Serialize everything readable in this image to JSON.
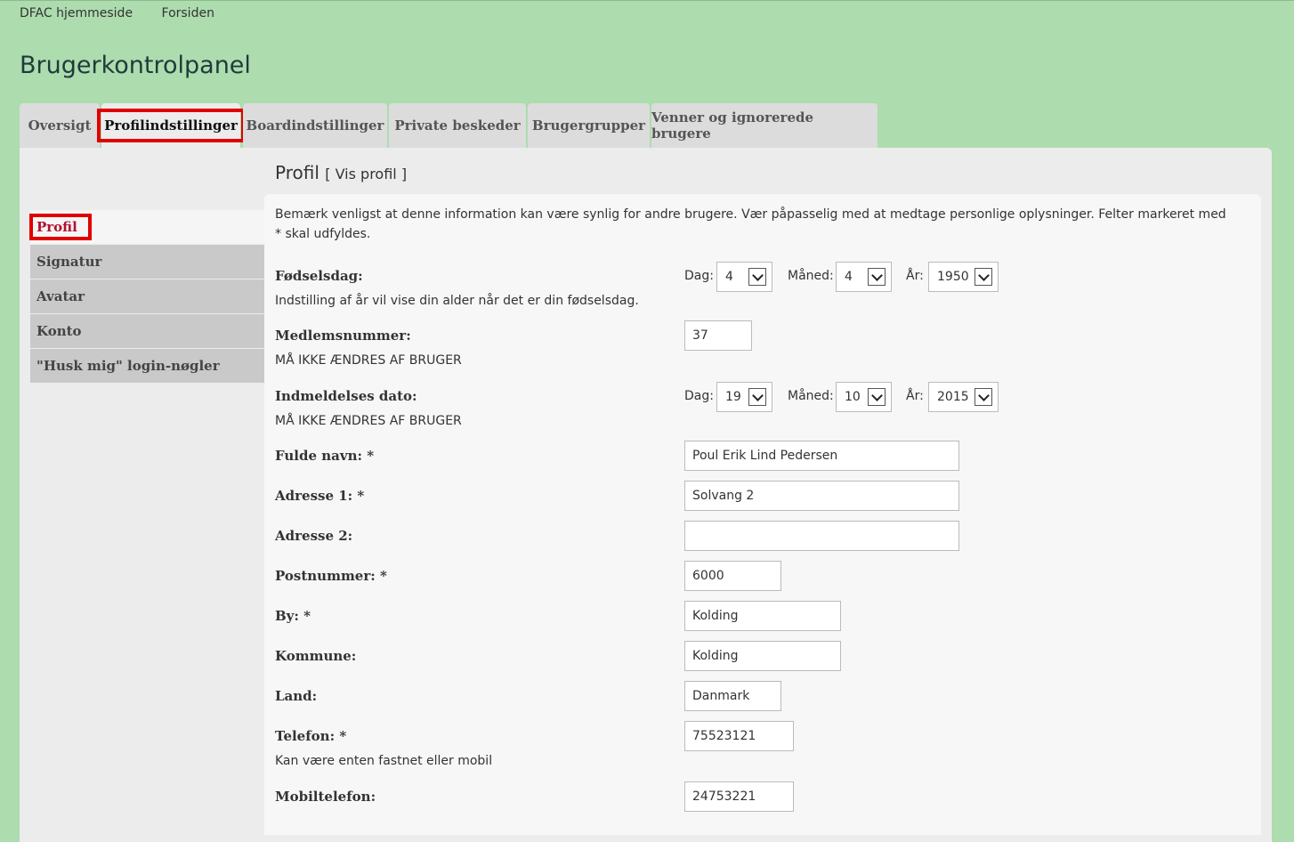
{
  "breadcrumbs": [
    "DFAC hjemmeside",
    "Forsiden"
  ],
  "page_title": "Brugerkontrolpanel",
  "tabs": [
    {
      "label": "Oversigt"
    },
    {
      "label": "Profilindstillinger"
    },
    {
      "label": "Boardindstillinger"
    },
    {
      "label": "Private beskeder"
    },
    {
      "label": "Brugergrupper"
    },
    {
      "label": "Venner og ignorerede brugere"
    }
  ],
  "active_tab": "Profilindstillinger",
  "sidebar": {
    "items": [
      {
        "label": "Profil"
      },
      {
        "label": "Signatur"
      },
      {
        "label": "Avatar"
      },
      {
        "label": "Konto"
      },
      {
        "label": "\"Husk mig\" login-nøgler"
      }
    ]
  },
  "panel": {
    "title": "Profil",
    "view_link": "[ Vis profil ]"
  },
  "form": {
    "notice": "Bemærk venligst at denne information kan være synlig for andre brugere. Vær påpasselig med at medtage personlige oplysninger. Felter markeret med * skal udfyldes.",
    "birthday": {
      "label": "Fødselsdag:",
      "hint": "Indstilling af år vil vise din alder når det er din fødselsdag.",
      "day_label": "Dag:",
      "day": "4",
      "month_label": "Måned:",
      "month": "4",
      "year_label": "År:",
      "year": "1950"
    },
    "member_number": {
      "label": "Medlemsnummer:",
      "hint": "MÅ IKKE ÆNDRES AF BRUGER",
      "value": "37"
    },
    "join_date": {
      "label": "Indmeldelses dato:",
      "hint": "MÅ IKKE ÆNDRES AF BRUGER",
      "day_label": "Dag:",
      "day": "19",
      "month_label": "Måned:",
      "month": "10",
      "year_label": "År:",
      "year": "2015"
    },
    "full_name": {
      "label": "Fulde navn: *",
      "value": "Poul Erik Lind Pedersen"
    },
    "address1": {
      "label": "Adresse 1: *",
      "value": "Solvang 2"
    },
    "address2": {
      "label": "Adresse 2:",
      "value": ""
    },
    "postal_code": {
      "label": "Postnummer: *",
      "value": "6000"
    },
    "city": {
      "label": "By: *",
      "value": "Kolding"
    },
    "municipality": {
      "label": "Kommune:",
      "value": "Kolding"
    },
    "country": {
      "label": "Land:",
      "value": "Danmark"
    },
    "phone": {
      "label": "Telefon: *",
      "hint": "Kan være enten fastnet eller mobil",
      "value": "75523121"
    },
    "mobile": {
      "label": "Mobiltelefon:",
      "value": "24753221"
    }
  }
}
